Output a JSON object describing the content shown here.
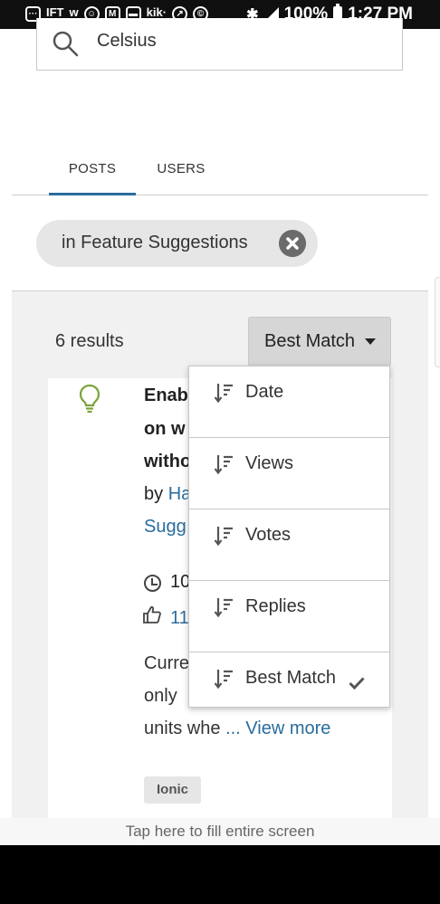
{
  "status_bar": {
    "left_icons": [
      "chat-icon",
      "ift-icon",
      "w-icon",
      "emoji-icon",
      "mail-icon",
      "message-icon",
      "kik-icon",
      "compass-icon",
      "vpn-icon"
    ],
    "ift_label": "IFT",
    "kik_label": "kik·",
    "battery": "100%",
    "time": "1:27 PM"
  },
  "search": {
    "value": "Celsius"
  },
  "tabs": [
    {
      "label": "POSTS",
      "active": true
    },
    {
      "label": "USERS",
      "active": false
    }
  ],
  "filter": {
    "label": "in Feature Suggestions"
  },
  "results": {
    "count_label": "6 results",
    "sort_label": "Best Match"
  },
  "post": {
    "title_line1": "Enab",
    "title_line2": "on w",
    "title_line3": "witho",
    "by_prefix": "by ",
    "author": "Ha",
    "board": "Sugg",
    "date": "10",
    "kudos": "11",
    "body_line1": "Curre",
    "body_line2": "only",
    "body_line3": "units whe",
    "view_more": "... View more",
    "tag": "Ionic"
  },
  "sort_options": [
    {
      "label": "Date",
      "selected": false
    },
    {
      "label": "Views",
      "selected": false
    },
    {
      "label": "Votes",
      "selected": false
    },
    {
      "label": "Replies",
      "selected": false
    },
    {
      "label": "Best Match",
      "selected": true
    }
  ],
  "fill_screen_hint": "Tap here to fill entire screen",
  "colors": {
    "accent": "#2a6c9e",
    "bulb": "#7aa33a",
    "chip_bg": "#e6e6e6"
  }
}
